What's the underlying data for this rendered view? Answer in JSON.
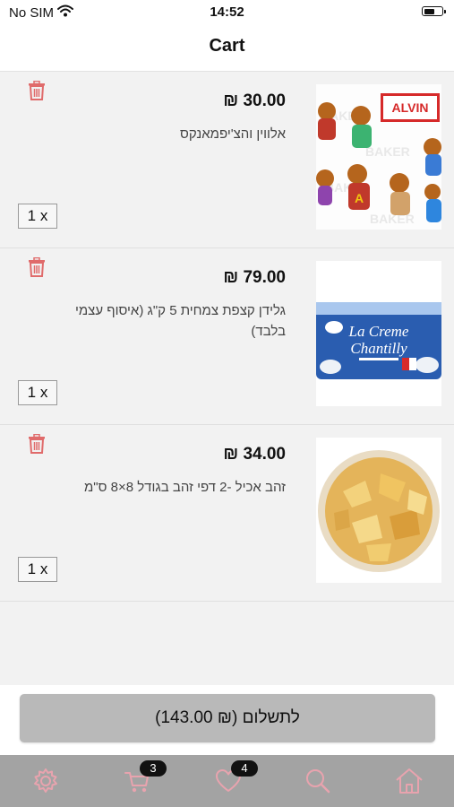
{
  "status_bar": {
    "carrier": "No SIM",
    "time": "14:52"
  },
  "nav": {
    "title": "Cart"
  },
  "items": [
    {
      "price": "30.00 ₪",
      "name": "אלווין והצ'יפמאנקס",
      "quantity": "1 x",
      "image_text": "ALVIN"
    },
    {
      "price": "79.00 ₪",
      "name": "גלידן קצפת צמחית 5 ק\"ג (איסוף עצמי בלבד)",
      "quantity": "1 x",
      "image_text_1": "La Creme",
      "image_text_2": "Chantilly"
    },
    {
      "price": "34.00 ₪",
      "name": "זהב אכיל -2 דפי זהב בגודל 8×8 ס\"מ",
      "quantity": "1 x"
    }
  ],
  "checkout": {
    "label": "לתשלום (₪ 143.00)"
  },
  "tab_bar": {
    "tabs": [
      {
        "icon": "gear-icon"
      },
      {
        "icon": "cart-icon",
        "badge": "3"
      },
      {
        "icon": "heart-icon",
        "badge": "4"
      },
      {
        "icon": "search-icon"
      },
      {
        "icon": "home-icon"
      }
    ]
  },
  "colors": {
    "icon_pink": "#e8a3ae",
    "trash_red": "#e06b6b",
    "tab_bar_bg": "#a3a3a3",
    "checkout_bg": "#b9b9b9"
  }
}
